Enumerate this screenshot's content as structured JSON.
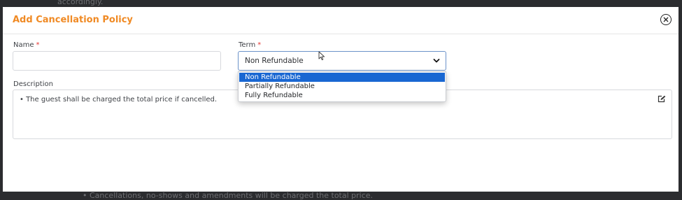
{
  "backdrop": {
    "top_text": "accordingly.",
    "bottom_text": "• Cancellations, no-shows and amendments will be charged the total price."
  },
  "modal": {
    "title": "Add Cancellation Policy",
    "close_icon": "close-circle-icon"
  },
  "form": {
    "name": {
      "label": "Name",
      "required_mark": "*",
      "value": ""
    },
    "term": {
      "label": "Term",
      "required_mark": "*",
      "selected": "Non Refundable",
      "options": [
        "Non Refundable",
        "Partially Refundable",
        "Fully Refundable"
      ],
      "open": true
    },
    "description": {
      "label": "Description",
      "text": "• The guest shall be charged the total price if cancelled.",
      "edit_icon": "edit-icon"
    }
  },
  "colors": {
    "accent": "#f08a24",
    "required": "#e53935",
    "selected_option": "#1967d2",
    "focus_border": "#6b92c9"
  }
}
